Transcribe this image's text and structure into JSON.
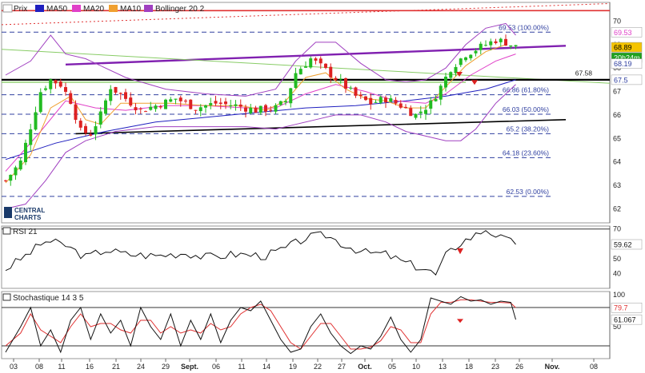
{
  "legend": [
    {
      "label": "Prix",
      "color": "#ffffff",
      "border": "#999999"
    },
    {
      "label": "MA50",
      "color": "#1f1fbf"
    },
    {
      "label": "MA20",
      "color": "#e040c8"
    },
    {
      "label": "MA10",
      "color": "#f0a030"
    },
    {
      "label": "Bollinger 20 2",
      "color": "#a040c0"
    }
  ],
  "logo": {
    "line1": "CENTRAL",
    "line2": "CHARTS"
  },
  "colors": {
    "up": "#22bb22",
    "down": "#dd2222",
    "ma50": "#1f1fbf",
    "ma20": "#e040c8",
    "ma10": "#f0a030",
    "bollinger": "#a040c0",
    "resistance": "#e03030",
    "channel": "#8020b0",
    "support": "#000000",
    "fib": "#3040a0",
    "trend_green": "#88cc66"
  },
  "x_labels": [
    "03",
    "08",
    "11",
    "16",
    "21",
    "24",
    "29",
    "Sept.",
    "06",
    "11",
    "14",
    "19",
    "22",
    "27",
    "Oct.",
    "05",
    "10",
    "13",
    "18",
    "23",
    "26",
    "Nov.",
    "08"
  ],
  "chart_data": [
    {
      "type": "candlestick",
      "panel": "price",
      "ylim": [
        61.4,
        70.8
      ],
      "yticks": [
        62,
        63,
        64,
        65,
        66,
        67,
        68,
        69,
        70
      ],
      "right_labels": {
        "last": "68.89",
        "countdown": "20h24m",
        "high": "69.53",
        "low": "68.19",
        "level": "67.5"
      },
      "fibonacci": [
        {
          "value": 69.53,
          "label": "69.53 (100.00%)"
        },
        {
          "value": 66.86,
          "label": "66.86 (61.80%)"
        },
        {
          "value": 66.03,
          "label": "66.03 (50.00%)"
        },
        {
          "value": 65.2,
          "label": "65.2 (38.20%)"
        },
        {
          "value": 64.18,
          "label": "64.18 (23.60%)"
        },
        {
          "value": 62.53,
          "label": "62.53 (0.00%)"
        }
      ],
      "level_label": "67.58",
      "close_path": [
        [
          0,
          63.2
        ],
        [
          3,
          64
        ],
        [
          5,
          65.5
        ],
        [
          7,
          67
        ],
        [
          9,
          67.5
        ],
        [
          11,
          67.3
        ],
        [
          13,
          66.6
        ],
        [
          15,
          65.3
        ],
        [
          17,
          65.2
        ],
        [
          19,
          66
        ],
        [
          21,
          67.2
        ],
        [
          24,
          66.7
        ],
        [
          27,
          66.2
        ],
        [
          30,
          66.4
        ],
        [
          34,
          66.7
        ],
        [
          38,
          66.3
        ],
        [
          42,
          66.5
        ],
        [
          46,
          66.4
        ],
        [
          50,
          66.2
        ],
        [
          54,
          66.3
        ],
        [
          56,
          66.6
        ],
        [
          58,
          67.8
        ],
        [
          61,
          68.4
        ],
        [
          64,
          67.9
        ],
        [
          67,
          67.4
        ],
        [
          70,
          66.8
        ],
        [
          73,
          66.5
        ],
        [
          76,
          66.7
        ],
        [
          79,
          66.4
        ],
        [
          82,
          66
        ],
        [
          85,
          66.5
        ],
        [
          87,
          67.2
        ],
        [
          89,
          68
        ],
        [
          92,
          68.6
        ],
        [
          95,
          68.9
        ],
        [
          98,
          69.2
        ],
        [
          100,
          69.1
        ],
        [
          102,
          68.9
        ]
      ],
      "ma10": [
        [
          0,
          63.1
        ],
        [
          5,
          64.3
        ],
        [
          9,
          66.3
        ],
        [
          13,
          66.8
        ],
        [
          16,
          65.8
        ],
        [
          19,
          65.6
        ],
        [
          23,
          66.5
        ],
        [
          27,
          66.5
        ],
        [
          33,
          66.5
        ],
        [
          40,
          66.4
        ],
        [
          47,
          66.4
        ],
        [
          52,
          66.2
        ],
        [
          56,
          66.6
        ],
        [
          60,
          67.6
        ],
        [
          64,
          67.8
        ],
        [
          68,
          67.1
        ],
        [
          72,
          66.7
        ],
        [
          76,
          66.6
        ],
        [
          80,
          66.3
        ],
        [
          84,
          66.3
        ],
        [
          88,
          67.2
        ],
        [
          92,
          68.1
        ],
        [
          96,
          68.7
        ],
        [
          100,
          69
        ]
      ],
      "ma20": [
        [
          0,
          63.6
        ],
        [
          7,
          65.3
        ],
        [
          12,
          66.6
        ],
        [
          18,
          66.3
        ],
        [
          24,
          66.2
        ],
        [
          32,
          66.4
        ],
        [
          40,
          66.4
        ],
        [
          48,
          66.3
        ],
        [
          54,
          66.3
        ],
        [
          60,
          66.9
        ],
        [
          66,
          67.3
        ],
        [
          72,
          67
        ],
        [
          78,
          66.6
        ],
        [
          84,
          66.5
        ],
        [
          88,
          66.9
        ],
        [
          93,
          67.7
        ],
        [
          98,
          68.3
        ],
        [
          102,
          68.6
        ]
      ],
      "ma50": [
        [
          0,
          64.1
        ],
        [
          10,
          64.8
        ],
        [
          20,
          65.3
        ],
        [
          30,
          65.7
        ],
        [
          40,
          65.9
        ],
        [
          50,
          66.1
        ],
        [
          60,
          66.3
        ],
        [
          70,
          66.4
        ],
        [
          80,
          66.6
        ],
        [
          88,
          66.8
        ],
        [
          96,
          67.1
        ],
        [
          102,
          67.5
        ]
      ],
      "bb_upper": [
        [
          0,
          67.7
        ],
        [
          5,
          68.3
        ],
        [
          9,
          69.4
        ],
        [
          12,
          68.6
        ],
        [
          16,
          68.4
        ],
        [
          24,
          67.6
        ],
        [
          32,
          67.1
        ],
        [
          40,
          66.9
        ],
        [
          48,
          66.8
        ],
        [
          54,
          67.1
        ],
        [
          58,
          68.3
        ],
        [
          62,
          69.1
        ],
        [
          66,
          69.1
        ],
        [
          71,
          68.2
        ],
        [
          76,
          67.5
        ],
        [
          80,
          67.4
        ],
        [
          84,
          67.5
        ],
        [
          88,
          68
        ],
        [
          92,
          69
        ],
        [
          96,
          69.7
        ],
        [
          100,
          69.9
        ],
        [
          102,
          69.4
        ]
      ],
      "bb_lower": [
        [
          0,
          62
        ],
        [
          4,
          62.2
        ],
        [
          8,
          63.2
        ],
        [
          12,
          64.4
        ],
        [
          16,
          64.9
        ],
        [
          22,
          65.3
        ],
        [
          30,
          65.5
        ],
        [
          40,
          65.5
        ],
        [
          48,
          65.5
        ],
        [
          54,
          65.4
        ],
        [
          58,
          65.6
        ],
        [
          62,
          65.8
        ],
        [
          66,
          66
        ],
        [
          71,
          66
        ],
        [
          76,
          65.7
        ],
        [
          80,
          65.3
        ],
        [
          84,
          65.1
        ],
        [
          88,
          64.9
        ],
        [
          91,
          64.9
        ],
        [
          94,
          65.4
        ],
        [
          98,
          66.5
        ],
        [
          102,
          67.3
        ]
      ]
    },
    {
      "type": "line",
      "panel": "rsi",
      "series": [
        {
          "name": "RSI 21",
          "values": [
            [
              0,
              43
            ],
            [
              4,
              52
            ],
            [
              8,
              62
            ],
            [
              12,
              59
            ],
            [
              16,
              51
            ],
            [
              20,
              56
            ],
            [
              24,
              53
            ],
            [
              30,
              52
            ],
            [
              36,
              54
            ],
            [
              40,
              51
            ],
            [
              46,
              53
            ],
            [
              52,
              52
            ],
            [
              56,
              57
            ],
            [
              60,
              64
            ],
            [
              64,
              66
            ],
            [
              68,
              59
            ],
            [
              72,
              54
            ],
            [
              76,
              53
            ],
            [
              80,
              47
            ],
            [
              84,
              43
            ],
            [
              86,
              39
            ],
            [
              88,
              52
            ],
            [
              91,
              61
            ],
            [
              94,
              66
            ],
            [
              96,
              70
            ],
            [
              99,
              64
            ],
            [
              102,
              59.62
            ]
          ]
        }
      ],
      "ylim": [
        30,
        72
      ],
      "yticks": [
        40,
        50,
        60,
        70
      ],
      "last": "59.62"
    },
    {
      "type": "line",
      "panel": "stochastic",
      "series": [
        {
          "name": "Stochastique 14 3 5",
          "values": [
            [
              0,
              10
            ],
            [
              3,
              50
            ],
            [
              5,
              80
            ],
            [
              7,
              20
            ],
            [
              9,
              45
            ],
            [
              11,
              10
            ],
            [
              13,
              60
            ],
            [
              15,
              80
            ],
            [
              17,
              30
            ],
            [
              19,
              70
            ],
            [
              21,
              40
            ],
            [
              23,
              60
            ],
            [
              25,
              20
            ],
            [
              27,
              80
            ],
            [
              29,
              50
            ],
            [
              31,
              30
            ],
            [
              33,
              70
            ],
            [
              35,
              20
            ],
            [
              37,
              60
            ],
            [
              39,
              30
            ],
            [
              41,
              70
            ],
            [
              43,
              25
            ],
            [
              45,
              60
            ],
            [
              47,
              80
            ],
            [
              49,
              75
            ],
            [
              51,
              90
            ],
            [
              53,
              60
            ],
            [
              55,
              30
            ],
            [
              57,
              10
            ],
            [
              59,
              15
            ],
            [
              61,
              50
            ],
            [
              63,
              70
            ],
            [
              65,
              40
            ],
            [
              67,
              20
            ],
            [
              69,
              8
            ],
            [
              71,
              20
            ],
            [
              73,
              15
            ],
            [
              75,
              35
            ],
            [
              77,
              65
            ],
            [
              79,
              30
            ],
            [
              81,
              10
            ],
            [
              83,
              30
            ],
            [
              85,
              95
            ],
            [
              87,
              90
            ],
            [
              89,
              85
            ],
            [
              91,
              97
            ],
            [
              93,
              90
            ],
            [
              95,
              92
            ],
            [
              97,
              85
            ],
            [
              99,
              90
            ],
            [
              101,
              88
            ],
            [
              102,
              61.067
            ]
          ]
        },
        {
          "name": "Stochastique 14 3 5",
          "values": [
            [
              0,
              20
            ],
            [
              3,
              40
            ],
            [
              5,
              70
            ],
            [
              7,
              45
            ],
            [
              9,
              35
            ],
            [
              11,
              25
            ],
            [
              13,
              50
            ],
            [
              15,
              70
            ],
            [
              17,
              50
            ],
            [
              19,
              55
            ],
            [
              21,
              55
            ],
            [
              23,
              45
            ],
            [
              25,
              40
            ],
            [
              27,
              60
            ],
            [
              29,
              60
            ],
            [
              31,
              40
            ],
            [
              33,
              50
            ],
            [
              35,
              40
            ],
            [
              37,
              45
            ],
            [
              39,
              40
            ],
            [
              41,
              55
            ],
            [
              43,
              45
            ],
            [
              45,
              50
            ],
            [
              47,
              70
            ],
            [
              49,
              80
            ],
            [
              51,
              85
            ],
            [
              53,
              75
            ],
            [
              55,
              50
            ],
            [
              57,
              25
            ],
            [
              59,
              15
            ],
            [
              61,
              35
            ],
            [
              63,
              55
            ],
            [
              65,
              55
            ],
            [
              67,
              35
            ],
            [
              69,
              15
            ],
            [
              71,
              15
            ],
            [
              73,
              18
            ],
            [
              75,
              28
            ],
            [
              77,
              50
            ],
            [
              79,
              45
            ],
            [
              81,
              25
            ],
            [
              83,
              25
            ],
            [
              85,
              70
            ],
            [
              87,
              88
            ],
            [
              89,
              88
            ],
            [
              91,
              92
            ],
            [
              93,
              92
            ],
            [
              95,
              90
            ],
            [
              97,
              88
            ],
            [
              99,
              88
            ],
            [
              101,
              87
            ],
            [
              102,
              79.7
            ]
          ]
        }
      ],
      "ylim": [
        0,
        105
      ],
      "yticks": [
        50,
        100
      ],
      "last_k": "61.067",
      "last_d": "79.7"
    }
  ]
}
